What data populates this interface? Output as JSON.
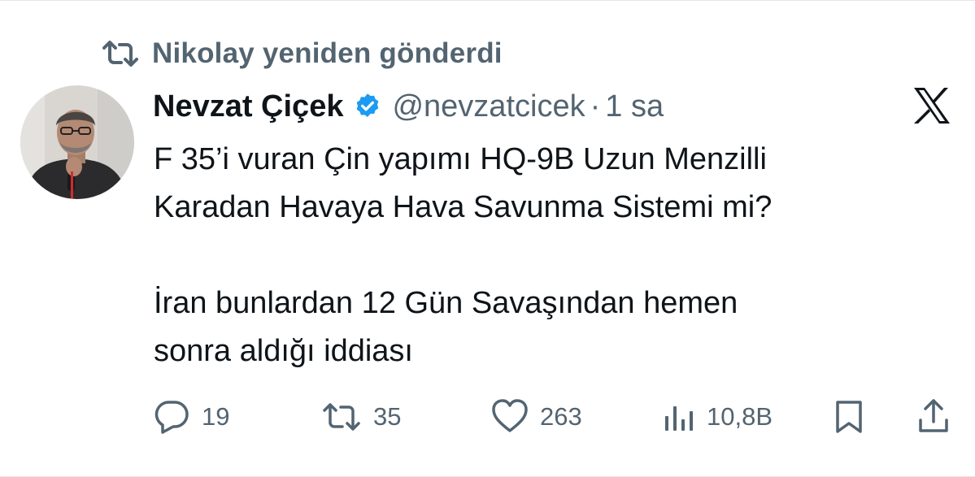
{
  "retweet_header": {
    "icon": "retweet-icon",
    "text": "Nikolay yeniden gönderdi"
  },
  "tweet": {
    "avatar_icon": "profile-photo",
    "author_name": "Nevzat Çiçek",
    "verified_icon": "verified-badge-icon",
    "handle": "@nevzatcicek",
    "separator": "·",
    "time": "1 sa",
    "logo_icon": "x-logo-icon",
    "text_lines": [
      "F 35’i vuran Çin yapımı HQ-9B Uzun Menzilli",
      "Karadan Havaya Hava Savunma Sistemi mi?",
      "",
      "İran bunlardan 12 Gün Savaşından hemen",
      "sonra aldığı iddiası"
    ]
  },
  "actions": {
    "reply": {
      "icon": "reply-icon",
      "count": "19"
    },
    "retweet": {
      "icon": "retweet-icon",
      "count": "35"
    },
    "like": {
      "icon": "heart-icon",
      "count": "263"
    },
    "views": {
      "icon": "views-chart-icon",
      "count": "10,8B"
    },
    "bookmark": {
      "icon": "bookmark-icon"
    },
    "share": {
      "icon": "share-icon"
    }
  },
  "colors": {
    "text_primary": "#0f1419",
    "text_secondary": "#536471",
    "verified_blue": "#1d9bf0",
    "background": "#ffffff"
  }
}
